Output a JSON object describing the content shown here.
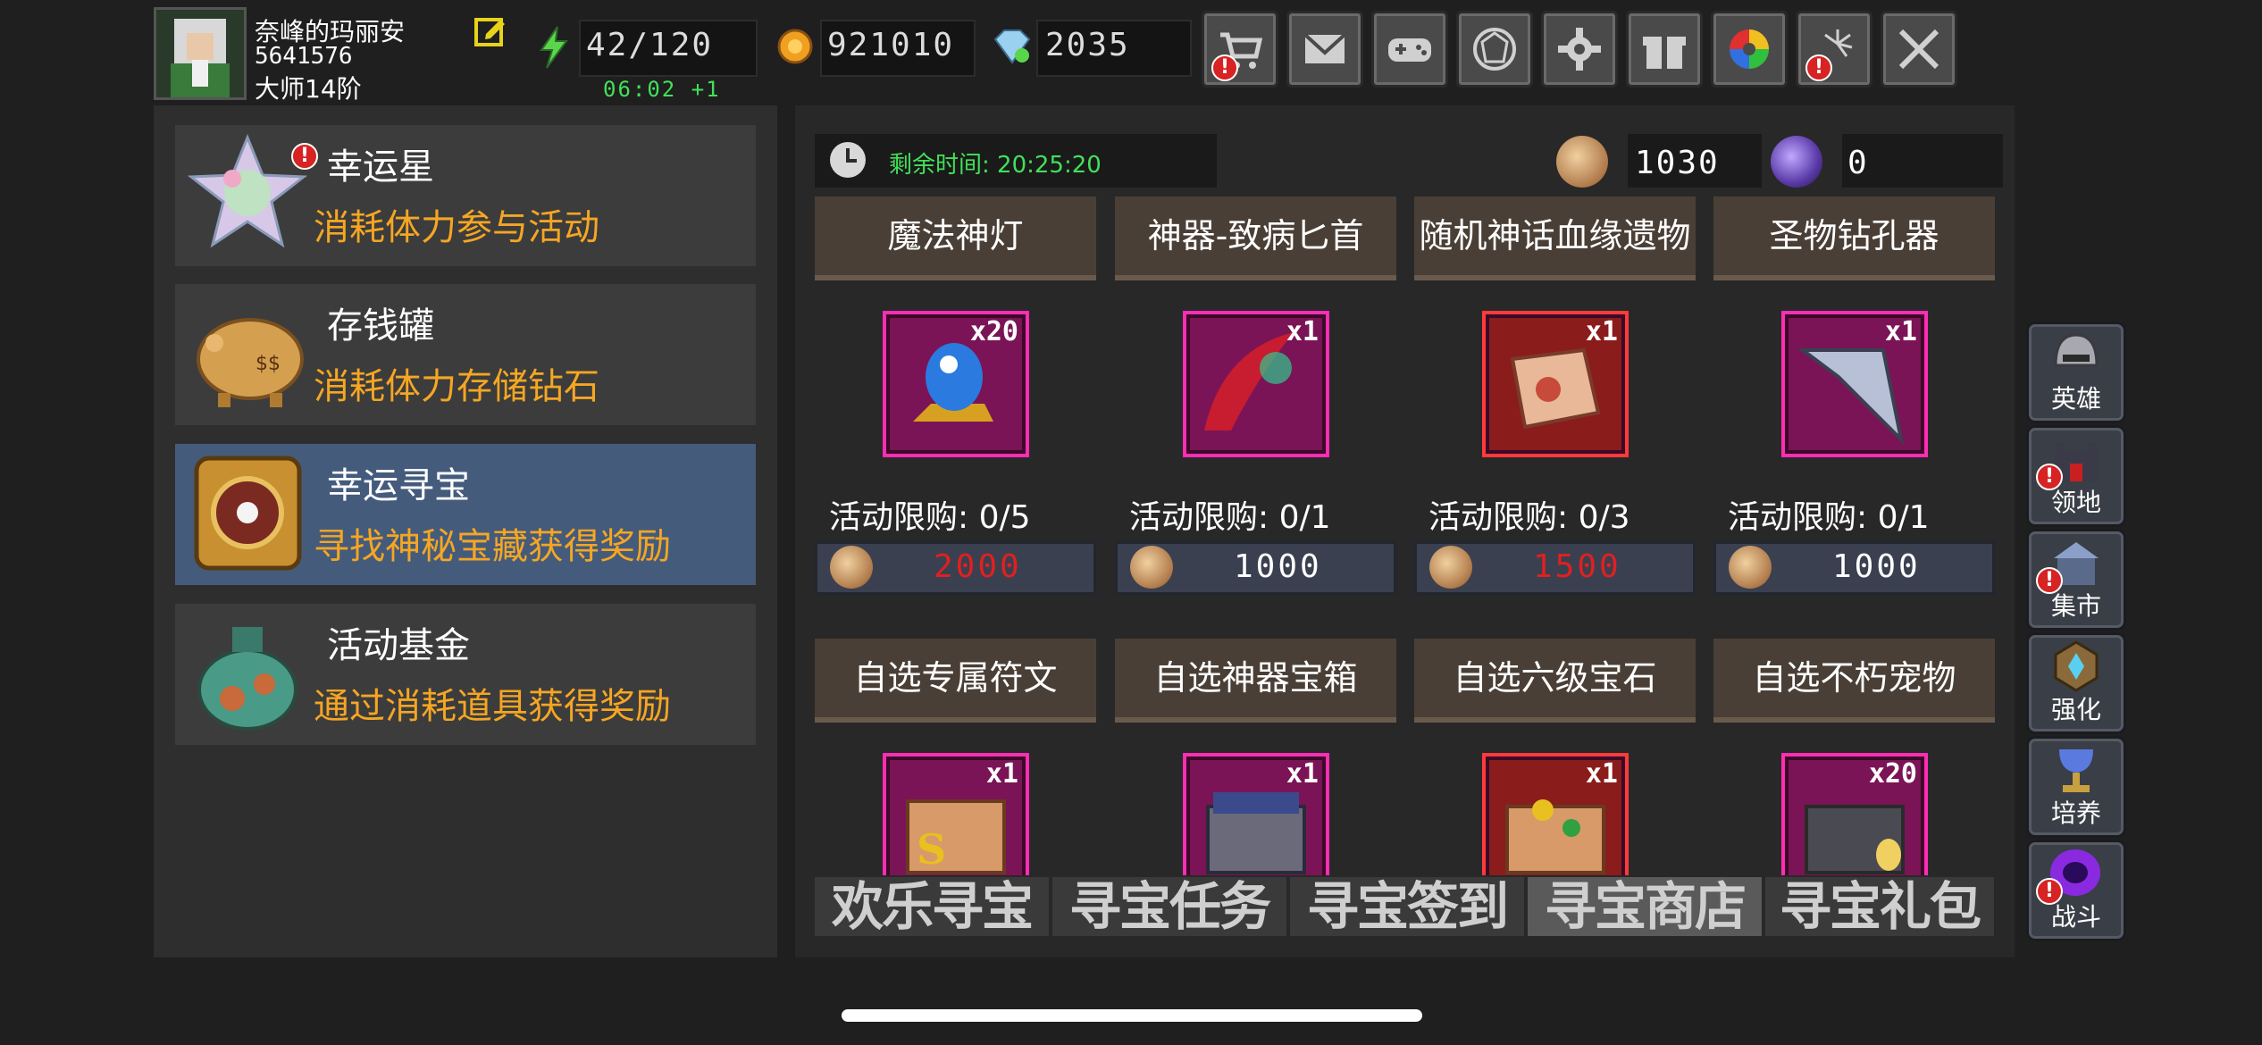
{
  "player": {
    "name": "奈峰的玛丽安",
    "id": "5641576",
    "rank": "大师14阶"
  },
  "resources": {
    "stamina": "42/120",
    "stamina_timer": "06:02 +1",
    "gold": "921010",
    "diamond": "2035"
  },
  "top_buttons": [
    "shop-icon",
    "mail-icon",
    "gamepad-icon",
    "guild-icon",
    "settings-icon",
    "gift-icon",
    "color-wheel-icon",
    "fireworks-icon",
    "battle-swords-icon"
  ],
  "events": [
    {
      "title": "幸运星",
      "desc": "消耗体力参与活动"
    },
    {
      "title": "存钱罐",
      "desc": "消耗体力存储钻石"
    },
    {
      "title": "幸运寻宝",
      "desc": "寻找神秘宝藏获得奖励"
    },
    {
      "title": "活动基金",
      "desc": "通过消耗道具获得奖励"
    }
  ],
  "shop": {
    "remaining_time": "剩余时间: 20:25:20",
    "currency1": "1030",
    "currency2": "0",
    "items": [
      {
        "name": "魔法神灯",
        "qty": "x20",
        "limit": "活动限购: 0/5",
        "price": "2000",
        "price_color": "#e02020"
      },
      {
        "name": "神器-致病匕首",
        "qty": "x1",
        "limit": "活动限购: 0/1",
        "price": "1000",
        "price_color": "#ffffff"
      },
      {
        "name": "随机神话血缘遗物",
        "qty": "x1",
        "limit": "活动限购: 0/3",
        "price": "1500",
        "price_color": "#e02020"
      },
      {
        "name": "圣物钻孔器",
        "qty": "x1",
        "limit": "活动限购: 0/1",
        "price": "1000",
        "price_color": "#ffffff"
      },
      {
        "name": "自选专属符文",
        "qty": "x1"
      },
      {
        "name": "自选神器宝箱",
        "qty": "x1"
      },
      {
        "name": "自选六级宝石",
        "qty": "x1"
      },
      {
        "name": "自选不朽宠物",
        "qty": "x20"
      }
    ],
    "tabs": [
      "欢乐寻宝",
      "寻宝任务",
      "寻宝签到",
      "寻宝商店",
      "寻宝礼包"
    ]
  },
  "side_buttons": [
    "英雄",
    "领地",
    "集市",
    "强化",
    "培养",
    "战斗"
  ],
  "alert_mark": "!",
  "colors": {
    "accent_orange": "#f5a623",
    "timer_green": "#42e05a",
    "selected_card": "#445b7c",
    "price_red": "#e02020"
  }
}
